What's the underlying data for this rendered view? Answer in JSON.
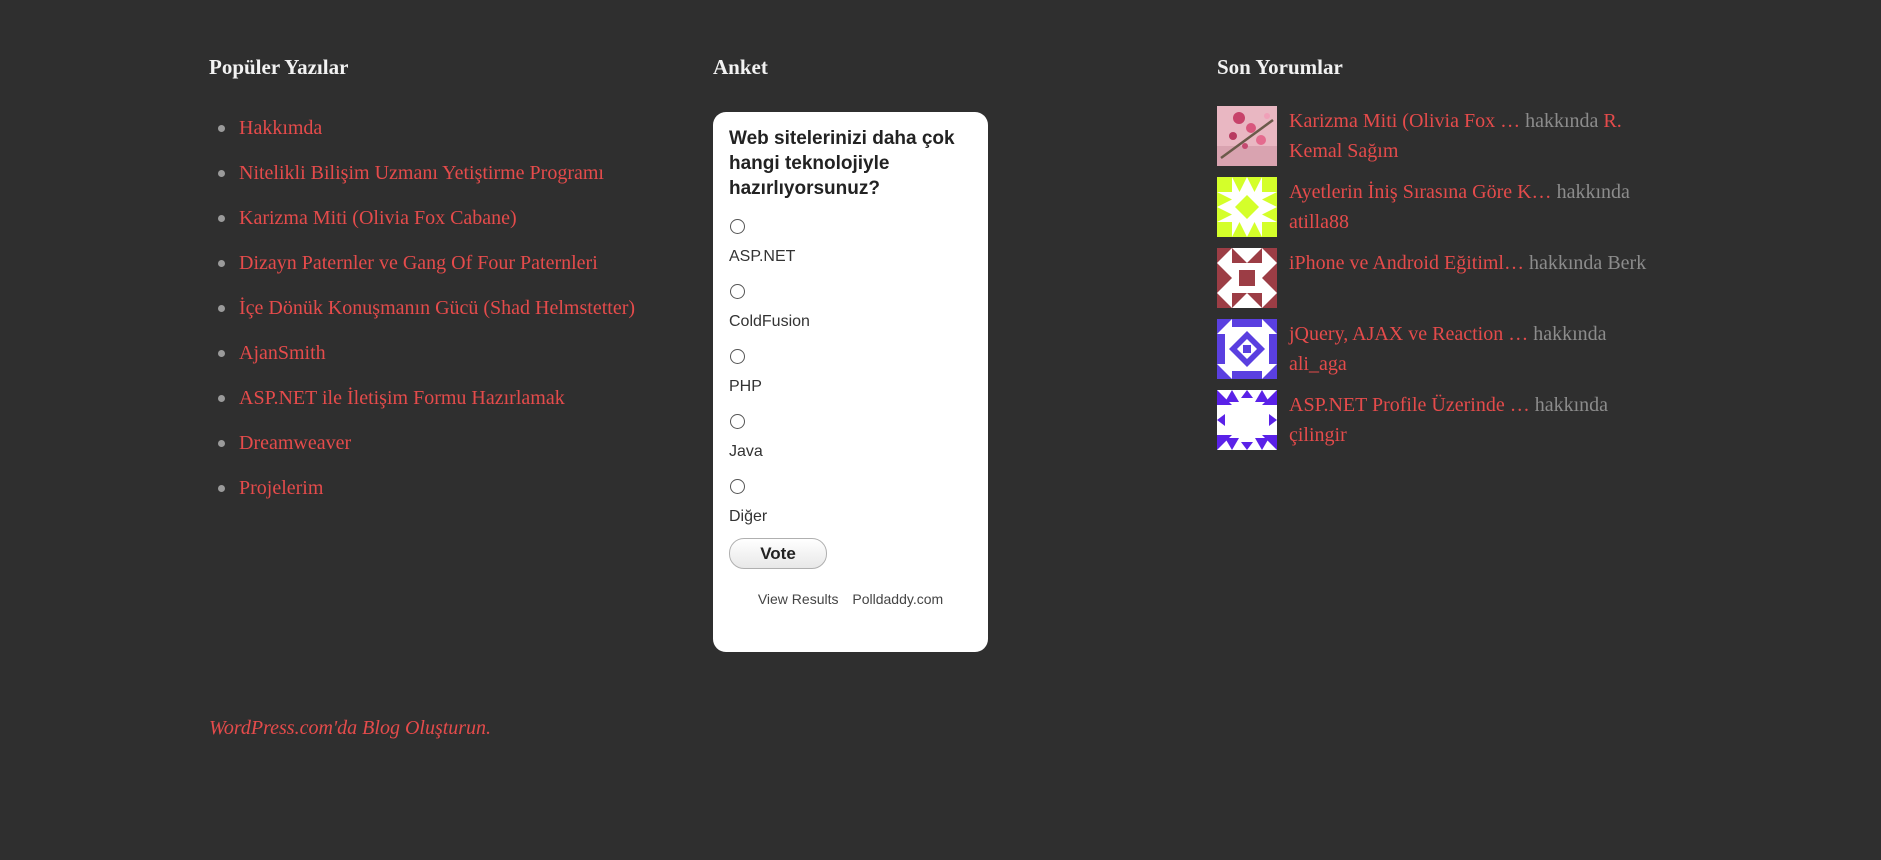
{
  "popular": {
    "title": "Popüler Yazılar",
    "items": [
      "Hakkımda",
      "Nitelikli Bilişim Uzmanı Yetiştirme Programı",
      "Karizma Miti (Olivia Fox Cabane)",
      "Dizayn Paternler ve Gang Of Four Paternleri",
      "İçe Dönük Konuşmanın Gücü (Shad Helmstetter)",
      "AjanSmith",
      "ASP.NET ile İletişim Formu Hazırlamak",
      "Dreamweaver",
      "Projelerim"
    ]
  },
  "poll": {
    "title": "Anket",
    "question": "Web sitelerinizi daha çok hangi teknolojiyle hazırlıyorsunuz?",
    "answers": [
      "ASP.NET",
      "ColdFusion",
      "PHP",
      "Java",
      "Diğer"
    ],
    "vote_label": "Vote",
    "view_results_label": "View Results",
    "polldaddy_label": "Polldaddy.com"
  },
  "comments": {
    "title": "Son Yorumlar",
    "items": [
      {
        "post": "Karizma Miti (Olivia Fox …",
        "about": "hakkında",
        "author": "R. Kemal Sağım",
        "author_is_link": true,
        "avatar": "pink-flower-photo-avatar"
      },
      {
        "post": "Ayetlerin İniş Sırasına Göre K…",
        "about": "hakkında",
        "author": "atilla88",
        "author_is_link": true,
        "avatar": "lime-identicon-avatar"
      },
      {
        "post": "iPhone ve Android Eğitiml…",
        "about": "hakkında",
        "author": "Berk",
        "author_is_link": false,
        "avatar": "maroon-identicon-avatar"
      },
      {
        "post": "jQuery, AJAX ve Reaction …",
        "about": "hakkında",
        "author": "ali_aga",
        "author_is_link": true,
        "avatar": "purple-identicon-avatar"
      },
      {
        "post": "ASP.NET Profile Üzerinde …",
        "about": "hakkında",
        "author": "çilingir",
        "author_is_link": true,
        "avatar": "violet-identicon-avatar"
      }
    ]
  },
  "footer": {
    "credit": "WordPress.com'da Blog Oluşturun."
  },
  "colors": {
    "background": "#2f2f2f",
    "link": "#e54b4b",
    "muted": "#8c8c8c",
    "heading": "#f2f2f2",
    "poll_bg": "#ffffff"
  }
}
